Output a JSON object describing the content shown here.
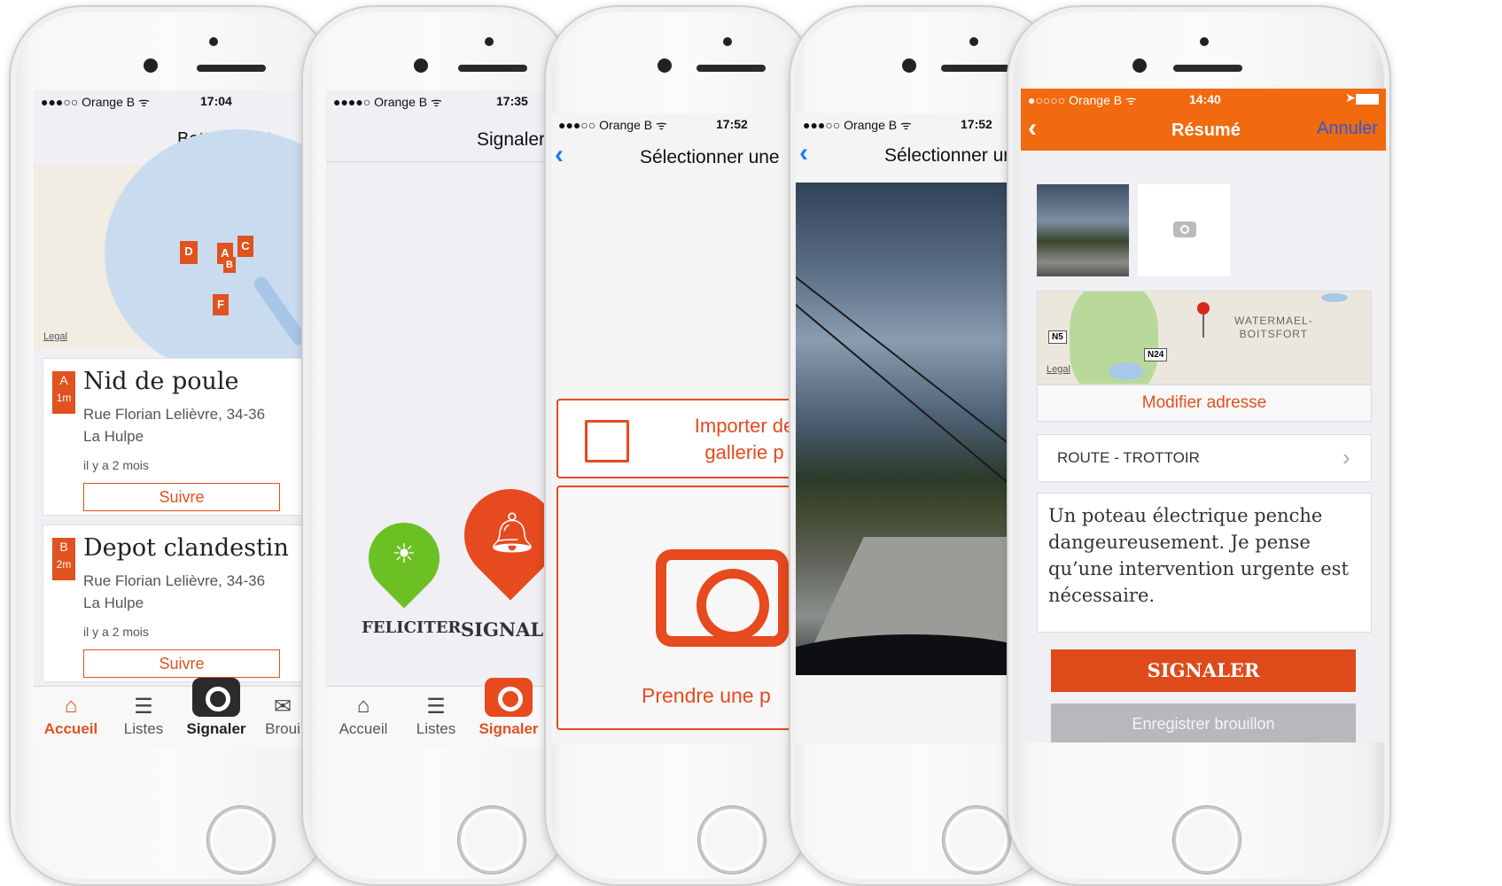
{
  "phone1": {
    "carrier": "●●●○○ Orange B ᯤ",
    "time": "17:04",
    "title": "BetterStreet",
    "map_legal": "Legal",
    "markers": [
      "D",
      "A",
      "C",
      "B",
      "F"
    ],
    "cards": [
      {
        "letter": "A",
        "distance": "1m",
        "title": "Nid de poule",
        "address1": "Rue Florian Lelièvre, 34-36",
        "address2": "La Hulpe",
        "ago": "il y a 2 mois",
        "follow": "Suivre"
      },
      {
        "letter": "B",
        "distance": "2m",
        "title": "Depot clandestin",
        "address1": "Rue Florian Lelièvre, 34-36",
        "address2": "La Hulpe",
        "ago": "il y a 2 mois",
        "follow": "Suivre"
      }
    ],
    "tabs": [
      {
        "label": "Accueil",
        "icon": "home-icon"
      },
      {
        "label": "Listes",
        "icon": "list-icon"
      },
      {
        "label": "Signaler",
        "icon": "camera-icon"
      },
      {
        "label": "Broui",
        "icon": "draft-icon"
      }
    ]
  },
  "phone2": {
    "carrier": "●●●●○ Orange B ᯤ",
    "time": "17:35",
    "title": "Signaler",
    "feliciter": "FELICITER",
    "signaler": "SIGNALER",
    "tabs": [
      {
        "label": "Accueil",
        "icon": "home-icon"
      },
      {
        "label": "Listes",
        "icon": "list-icon"
      },
      {
        "label": "Signaler",
        "icon": "camera-icon"
      }
    ]
  },
  "phone3": {
    "carrier": "●●●○○ Orange B ᯤ",
    "time": "17:52",
    "title": "Sélectionner une",
    "import_line1": "Importer de",
    "import_line2": "gallerie p",
    "take_photo": "Prendre une p"
  },
  "phone4": {
    "carrier": "●●●○○ Orange B ᯤ",
    "time": "17:52",
    "title": "Sélectionner ur"
  },
  "phone5": {
    "carrier": "●○○○○ Orange B ᯤ",
    "time": "14:40",
    "title": "Résumé",
    "cancel": "Annuler",
    "map_labels": {
      "n5": "N5",
      "n24": "N24",
      "city1": "Watermael-",
      "city2": "Boitsfort",
      "legal": "Legal"
    },
    "modify_address": "Modifier adresse",
    "category": "ROUTE - TROTTOIR",
    "description": "Un poteau électrique penche dangeureusement. Je pense qu’une intervention urgente est nécessaire.",
    "submit": "SIGNALER",
    "save_draft": "Enregistrer brouillon"
  },
  "colors": {
    "accent": "#e0521f",
    "green": "#6cc024",
    "ios_blue": "#1a7cf5"
  }
}
